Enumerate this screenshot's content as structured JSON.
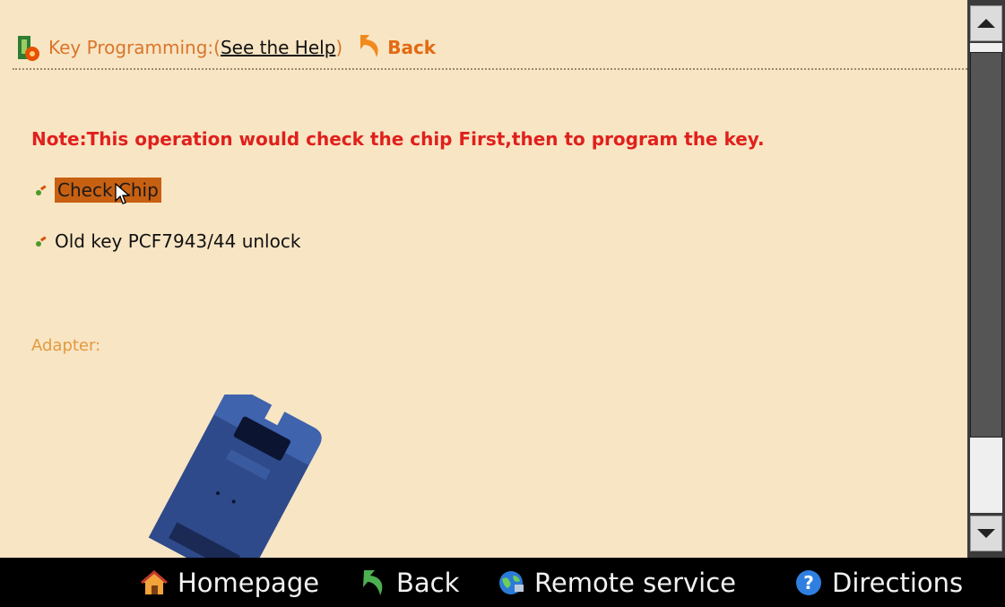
{
  "header": {
    "title": "Key Programming:(",
    "help_link": "See the Help",
    "close_paren": ")",
    "back_label": "Back"
  },
  "note": "Note:This operation would check the chip First,then to program the key.",
  "options": [
    {
      "label": "Check Chip",
      "highlighted": true
    },
    {
      "label": "Old key PCF7943/44 unlock",
      "highlighted": false
    }
  ],
  "adapter_label": "Adapter:",
  "taskbar": {
    "home": "Homepage",
    "back": "Back",
    "remote": "Remote service",
    "directions": "Directions"
  },
  "colors": {
    "background": "#f8e5c4",
    "note": "#e0201c",
    "highlight": "#c86012",
    "taskbar": "#000000"
  }
}
